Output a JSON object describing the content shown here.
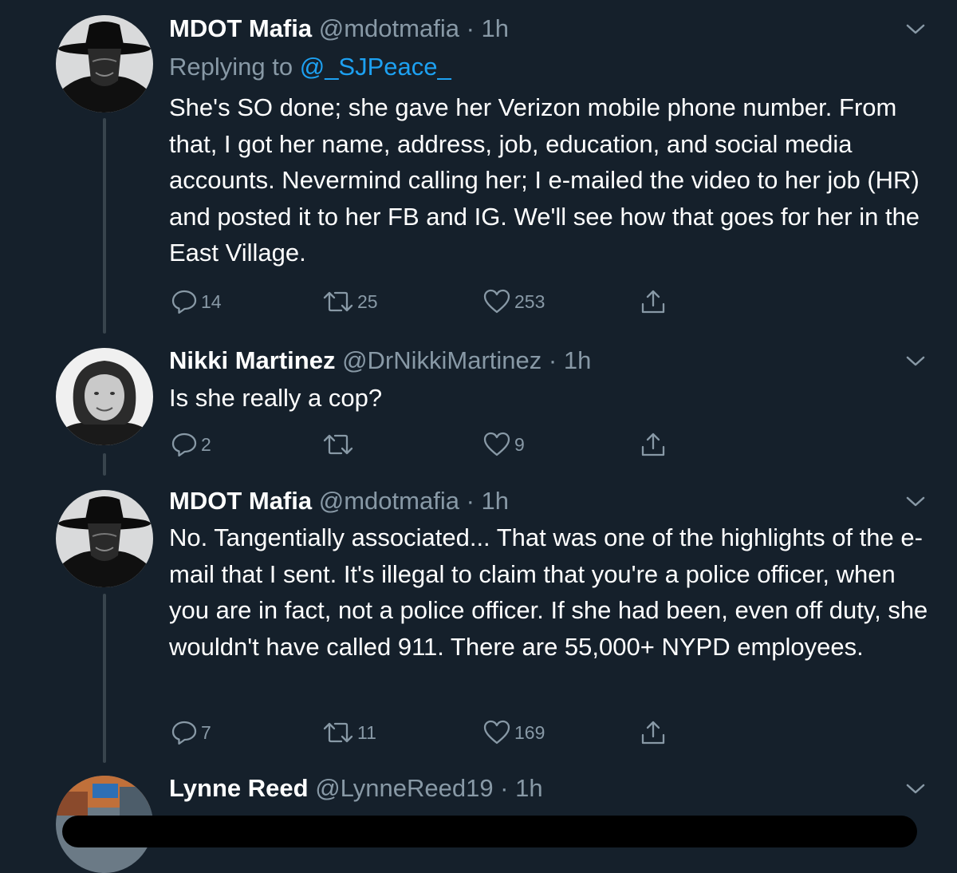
{
  "tweets": [
    {
      "name": "MDOT Mafia",
      "handle": "@mdotmafia",
      "time": "1h",
      "replying_prefix": "Replying to",
      "replying_to": "@_SJPeace_",
      "text": "She's SO done; she gave her Verizon mobile phone number. From that, I got her name, address, job, education, and social media accounts. Nevermind calling her; I e-mailed the video to her job (HR) and posted it to her FB and IG. We'll see how that goes for her in the East Village.",
      "replies": "14",
      "retweets": "25",
      "likes": "253",
      "avatar": "masked-figure-avatar"
    },
    {
      "name": "Nikki Martinez",
      "handle": "@DrNikkiMartinez",
      "time": "1h",
      "text": "Is she really a cop?",
      "replies": "2",
      "retweets": "",
      "likes": "9",
      "avatar": "woman-portrait-avatar"
    },
    {
      "name": "MDOT Mafia",
      "handle": "@mdotmafia",
      "time": "1h",
      "text": "No. Tangentially associated... That was one of the highlights of the e-mail that I sent. It's illegal to claim that you're a police officer, when you are in fact, not a police officer. If she had been, even off duty, she wouldn't have called 911. There are 55,000+ NYPD employees.",
      "replies": "7",
      "retweets": "11",
      "likes": "169",
      "avatar": "masked-figure-avatar"
    },
    {
      "name": "Lynne Reed",
      "handle": "@LynneReed19",
      "time": "1h",
      "avatar": "photo-avatar"
    }
  ],
  "separator": " · ",
  "colors": {
    "background": "#15202b",
    "secondary_text": "#8899a6",
    "link": "#1da1f2",
    "thread_line": "#38444d"
  }
}
